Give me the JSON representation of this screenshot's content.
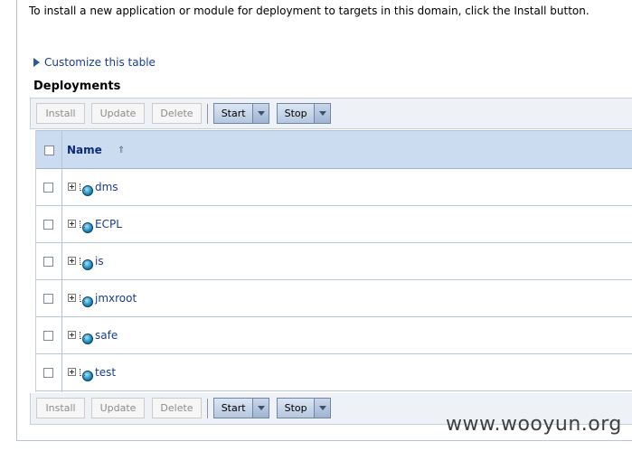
{
  "intro_text": "To install a new application or module for deployment to targets in this domain, click the Install button.",
  "customize_link": "Customize this table",
  "section_title": "Deployments",
  "toolbar": {
    "install_label": "Install",
    "update_label": "Update",
    "delete_label": "Delete",
    "start_label": "Start",
    "stop_label": "Stop"
  },
  "table": {
    "name_header": "Name",
    "sort_icon": "⇑",
    "rows": [
      {
        "name": "dms"
      },
      {
        "name": "ECPL"
      },
      {
        "name": "is"
      },
      {
        "name": "jmxroot"
      },
      {
        "name": "safe"
      },
      {
        "name": "test"
      }
    ]
  },
  "watermark": "www.wooyun.org"
}
